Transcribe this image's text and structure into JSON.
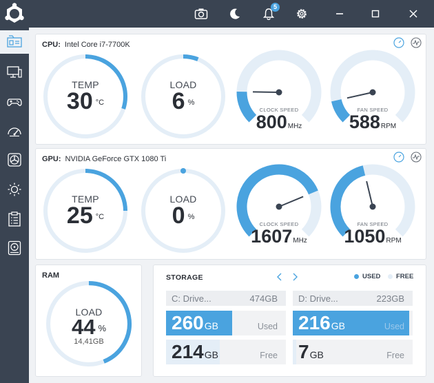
{
  "colors": {
    "accent": "#4aa3df",
    "track": "#e4eef7",
    "sidebar": "#3a4452",
    "needle": "#3a4452"
  },
  "titlebar": {
    "icons": [
      "logo-icon",
      "screenshot-icon",
      "moon-icon",
      "bell-icon",
      "gear-icon",
      "minimize-icon",
      "maximize-icon",
      "close-icon"
    ],
    "notification_count": "5"
  },
  "sidebar": {
    "items": [
      {
        "icon": "dashboard-icon",
        "active": true
      },
      {
        "icon": "computer-icon",
        "active": false
      },
      {
        "icon": "gamepad-icon",
        "active": false
      },
      {
        "icon": "speedometer-icon",
        "active": false
      },
      {
        "icon": "fan-icon",
        "active": false
      },
      {
        "icon": "brightness-icon",
        "active": false
      },
      {
        "icon": "clipboard-icon",
        "active": false
      },
      {
        "icon": "disk-icon",
        "active": false
      }
    ]
  },
  "cpu": {
    "label": "CPU:",
    "device": "Intel Core i7-7700K",
    "temp": {
      "caption": "TEMP",
      "value": "30",
      "unit": "°C",
      "level": 0.3
    },
    "load": {
      "caption": "LOAD",
      "value": "6",
      "unit": "%",
      "level": 0.06
    },
    "clock": {
      "caption": "CLOCK SPEED",
      "value": "800",
      "unit": "MHz",
      "level": 0.17
    },
    "fan": {
      "caption": "FAN SPEED",
      "value": "588",
      "unit": "RPM",
      "level": 0.12
    }
  },
  "gpu": {
    "label": "GPU:",
    "device": "NVIDIA GeForce GTX 1080 Ti",
    "temp": {
      "caption": "TEMP",
      "value": "25",
      "unit": "°C",
      "level": 0.25
    },
    "load": {
      "caption": "LOAD",
      "value": "0",
      "unit": "%",
      "level": 0.0
    },
    "clock": {
      "caption": "CLOCK SPEED",
      "value": "1607",
      "unit": "MHz",
      "level": 0.75
    },
    "fan": {
      "caption": "FAN SPEED",
      "value": "1050",
      "unit": "RPM",
      "level": 0.45
    }
  },
  "ram": {
    "label": "RAM",
    "caption": "LOAD",
    "value": "44",
    "unit": "%",
    "used": "14,41GB",
    "level": 0.44
  },
  "storage": {
    "title": "STORAGE",
    "legend_used": "USED",
    "legend_free": "FREE",
    "used_label": "Used",
    "free_label": "Free",
    "drives": [
      {
        "name": "C: Drive...",
        "size": "474GB",
        "used": "260",
        "free": "214",
        "unit": "GB",
        "used_frac": 0.55,
        "free_frac": 0.45
      },
      {
        "name": "D: Drive...",
        "size": "223GB",
        "used": "216",
        "free": "7",
        "unit": "GB",
        "used_frac": 0.97,
        "free_frac": 0.03
      }
    ]
  }
}
